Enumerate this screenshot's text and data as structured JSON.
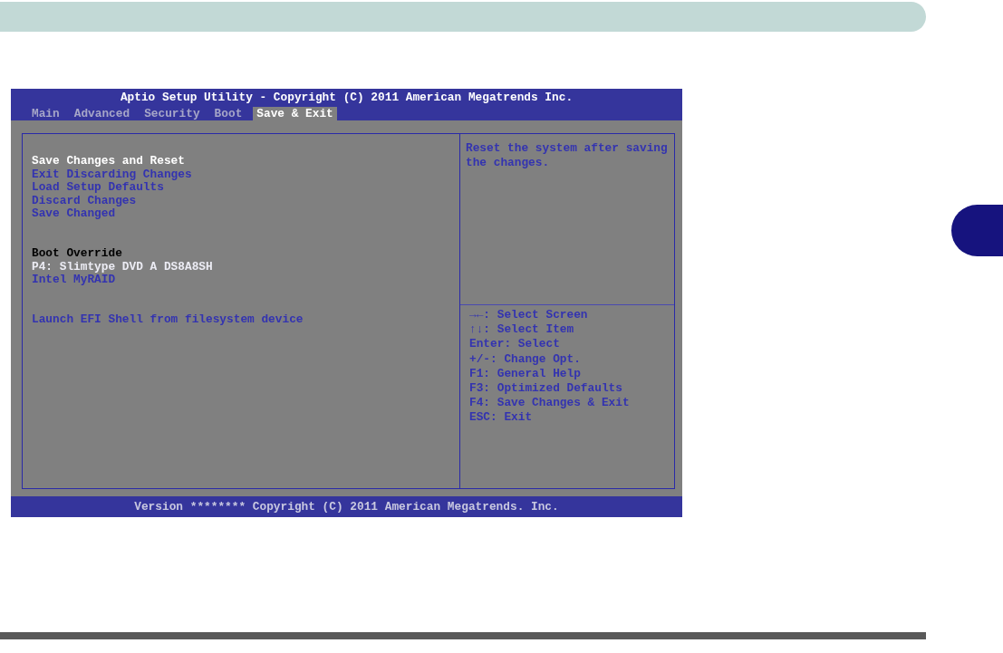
{
  "bios": {
    "title": "Aptio Setup Utility - Copyright (C) 2011 American Megatrends Inc.",
    "tabs": [
      {
        "label": "Main",
        "selected": false
      },
      {
        "label": "Advanced",
        "selected": false
      },
      {
        "label": "Security",
        "selected": false
      },
      {
        "label": "Boot",
        "selected": false
      },
      {
        "label": "Save & Exit",
        "selected": true
      }
    ],
    "menu_groups": [
      [
        {
          "label": "Save Changes and Reset",
          "kind": "option",
          "selected": true
        },
        {
          "label": "Exit Discarding Changes",
          "kind": "option",
          "selected": false
        },
        {
          "label": "Load Setup Defaults",
          "kind": "option",
          "selected": false
        },
        {
          "label": "Discard Changes",
          "kind": "option",
          "selected": false
        },
        {
          "label": "Save Changed",
          "kind": "option",
          "selected": false
        }
      ],
      [
        {
          "label": "Boot Override",
          "kind": "heading",
          "selected": false
        },
        {
          "label": "P4: Slimtype DVD A DS8A8SH",
          "kind": "device",
          "selected": false
        },
        {
          "label": "Intel MyRAID",
          "kind": "option",
          "selected": false
        }
      ],
      [
        {
          "label": "Launch EFI Shell from filesystem device",
          "kind": "option",
          "selected": false
        }
      ]
    ],
    "help_text": "Reset the system after saving the changes.",
    "key_help": [
      "→←: Select Screen",
      "↑↓: Select Item",
      "Enter: Select",
      "+/-: Change Opt.",
      "F1: General Help",
      "F3: Optimized Defaults",
      "F4: Save Changes & Exit",
      "ESC: Exit"
    ],
    "footer": "Version ******** Copyright (C) 2011 American Megatrends. Inc."
  }
}
